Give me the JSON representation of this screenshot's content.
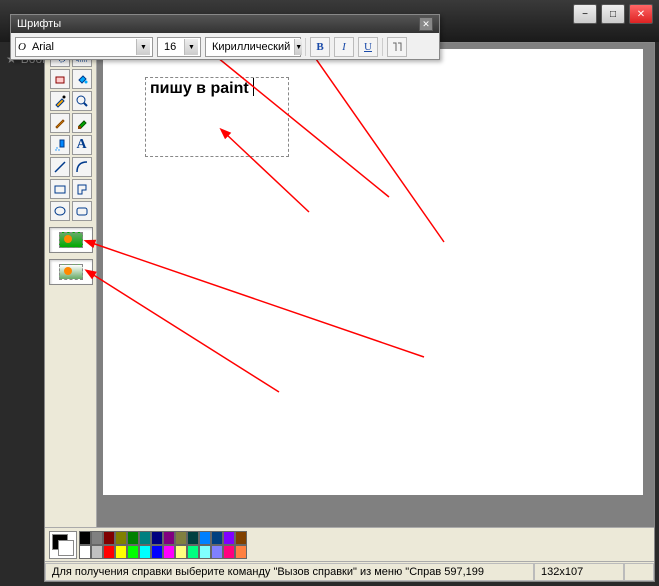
{
  "browser": {
    "bookmark_label": "Book"
  },
  "font_toolbar": {
    "title": "Шрифты",
    "font_family": "Arial",
    "font_size": "16",
    "script": "Кириллический",
    "bold": "B",
    "italic": "I",
    "underline": "U"
  },
  "canvas": {
    "text_content": "пишу в paint"
  },
  "palette": {
    "colors_row1": [
      "#000000",
      "#808080",
      "#800000",
      "#808000",
      "#008000",
      "#008080",
      "#000080",
      "#800080",
      "#808040",
      "#004040",
      "#0080ff",
      "#004080",
      "#8000ff",
      "#804000"
    ],
    "colors_row2": [
      "#ffffff",
      "#c0c0c0",
      "#ff0000",
      "#ffff00",
      "#00ff00",
      "#00ffff",
      "#0000ff",
      "#ff00ff",
      "#ffff80",
      "#00ff80",
      "#80ffff",
      "#8080ff",
      "#ff0080",
      "#ff8040"
    ]
  },
  "status": {
    "help_text": "Для получения справки выберите команду \"Вызов справки\" из меню \"Справ 597,199",
    "dimensions": "132x107"
  },
  "tools": {
    "names": [
      "free-select",
      "rect-select",
      "eraser",
      "fill",
      "picker",
      "magnifier",
      "pencil",
      "brush",
      "airbrush",
      "text",
      "line",
      "curve",
      "rectangle",
      "polygon",
      "ellipse",
      "rounded-rect"
    ]
  }
}
